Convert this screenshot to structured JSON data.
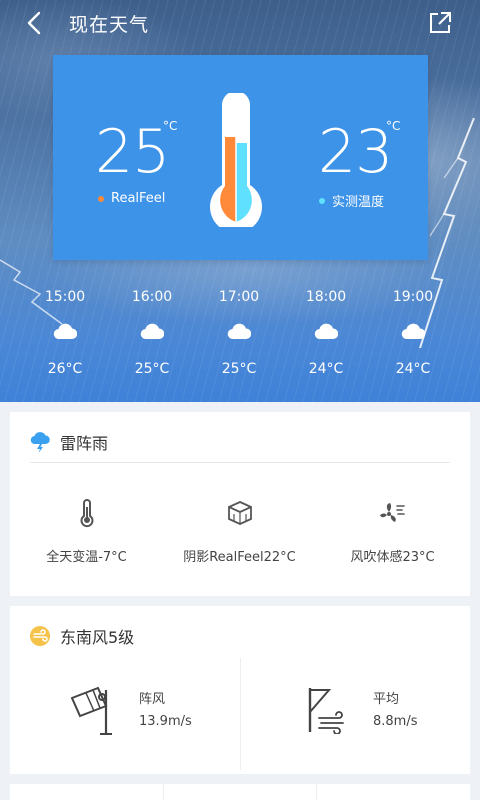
{
  "header": {
    "title": "现在天气",
    "back_icon": "chevron-left-icon",
    "share_icon": "share-external-icon"
  },
  "temperature_card": {
    "realfeel": {
      "value": "25",
      "unit": "°C",
      "label": "RealFeel",
      "dot_color": "#ff8a3a"
    },
    "measured": {
      "value": "23",
      "unit": "°C",
      "label": "实测温度",
      "dot_color": "#5fe0ff"
    },
    "card_color": "#3d93e8"
  },
  "hourly": [
    {
      "time": "15:00",
      "icon": "cloud-icon",
      "temp": "26°C"
    },
    {
      "time": "16:00",
      "icon": "cloud-icon",
      "temp": "25°C"
    },
    {
      "time": "17:00",
      "icon": "cloud-icon",
      "temp": "25°C"
    },
    {
      "time": "18:00",
      "icon": "cloud-icon",
      "temp": "24°C"
    },
    {
      "time": "19:00",
      "icon": "cloud-icon",
      "temp": "24°C"
    }
  ],
  "condition_card": {
    "title": "雷阵雨",
    "icon": "thunderstorm-icon",
    "details": [
      {
        "icon": "thermometer-icon",
        "text": "全天变温-7°C"
      },
      {
        "icon": "shade-box-icon",
        "text": "阴影RealFeel22°C"
      },
      {
        "icon": "fan-wind-icon",
        "text": "风吹体感23°C"
      }
    ]
  },
  "wind_card": {
    "title": "东南风5级",
    "icon": "wind-badge-icon",
    "gust": {
      "label": "阵风",
      "value": "13.9m/s",
      "icon": "windsock-icon"
    },
    "average": {
      "label": "平均",
      "value": "8.8m/s",
      "icon": "wind-flag-icon"
    }
  },
  "colors": {
    "accent_blue": "#3d93e8",
    "realfeel_orange": "#ff8a3a",
    "measured_cyan": "#5fe0ff",
    "wind_badge": "#f5c24a",
    "storm_icon_blue": "#3aa0f0"
  }
}
